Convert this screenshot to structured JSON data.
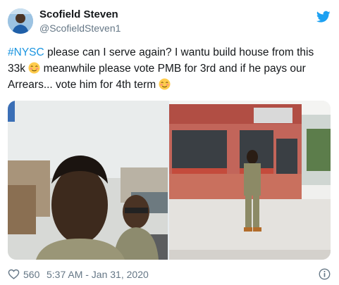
{
  "user": {
    "name": "Scofield Steven",
    "handle": "@ScofieldSteven1"
  },
  "tweet": {
    "hashtag": "#NYSC",
    "text_part1": " please can I serve again? I wantu build house from this 33k ",
    "text_part2": " meanwhile please vote PMB for 3rd and if he pays our Arrears... vote him for 4th term ",
    "emoji": "relieved-smiling-face"
  },
  "media": {
    "count": 2,
    "images": [
      "selfie-two-young-men",
      "man-in-uniform-outside-building"
    ]
  },
  "footer": {
    "likes": "560",
    "timestamp": "5:37 AM - Jan 31, 2020"
  },
  "colors": {
    "link": "#1b95e0",
    "twitter_bird": "#1da1f2",
    "secondary_text": "#657786"
  }
}
